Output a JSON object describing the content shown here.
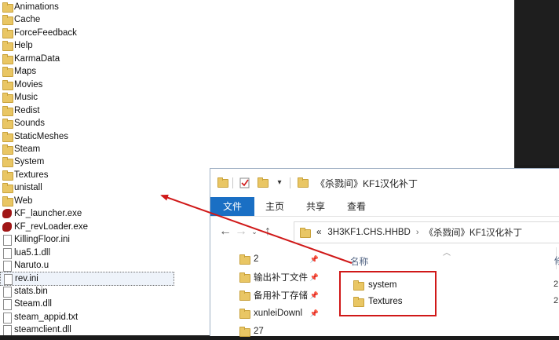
{
  "left_list": {
    "items": [
      {
        "name": "Animations",
        "type": "folder"
      },
      {
        "name": "Cache",
        "type": "folder"
      },
      {
        "name": "ForceFeedback",
        "type": "folder"
      },
      {
        "name": "Help",
        "type": "folder"
      },
      {
        "name": "KarmaData",
        "type": "folder"
      },
      {
        "name": "Maps",
        "type": "folder"
      },
      {
        "name": "Movies",
        "type": "folder"
      },
      {
        "name": "Music",
        "type": "folder"
      },
      {
        "name": "Redist",
        "type": "folder"
      },
      {
        "name": "Sounds",
        "type": "folder"
      },
      {
        "name": "StaticMeshes",
        "type": "folder"
      },
      {
        "name": "Steam",
        "type": "folder"
      },
      {
        "name": "System",
        "type": "folder"
      },
      {
        "name": "Textures",
        "type": "folder"
      },
      {
        "name": "unistall",
        "type": "folder"
      },
      {
        "name": "Web",
        "type": "folder"
      },
      {
        "name": "KF_launcher.exe",
        "type": "exe"
      },
      {
        "name": "KF_revLoader.exe",
        "type": "exe"
      },
      {
        "name": "KillingFloor.ini",
        "type": "file"
      },
      {
        "name": "lua5.1.dll",
        "type": "file"
      },
      {
        "name": "Naruto.u",
        "type": "file"
      },
      {
        "name": "rev.ini",
        "type": "file",
        "selected": true
      },
      {
        "name": "stats.bin",
        "type": "file"
      },
      {
        "name": "Steam.dll",
        "type": "file"
      },
      {
        "name": "steam_appid.txt",
        "type": "file"
      },
      {
        "name": "steamclient.dll",
        "type": "file"
      }
    ]
  },
  "window": {
    "title": "《杀戮间》KF1汉化补丁",
    "ribbon_tabs": [
      "文件",
      "主页",
      "共享",
      "查看"
    ],
    "address": {
      "prefix": "«",
      "crumbs": [
        "3H3KF1.CHS.HHBD",
        "《杀戮间》KF1汉化补丁"
      ],
      "separator": "›"
    },
    "nav_items": [
      {
        "label": "2"
      },
      {
        "label": "输出补丁文件"
      },
      {
        "label": "备用补丁存储"
      },
      {
        "label": "xunleiDownl"
      },
      {
        "label": "27"
      }
    ],
    "column_header": "名称",
    "column_header_right": "修",
    "items": [
      {
        "name": "system",
        "date_digit": "2"
      },
      {
        "name": "Textures",
        "date_digit": "2"
      }
    ]
  },
  "colors": {
    "annotation_red": "#d01818",
    "ribbon_file_blue": "#1a6fc4",
    "folder_yellow": "#e9c664"
  }
}
